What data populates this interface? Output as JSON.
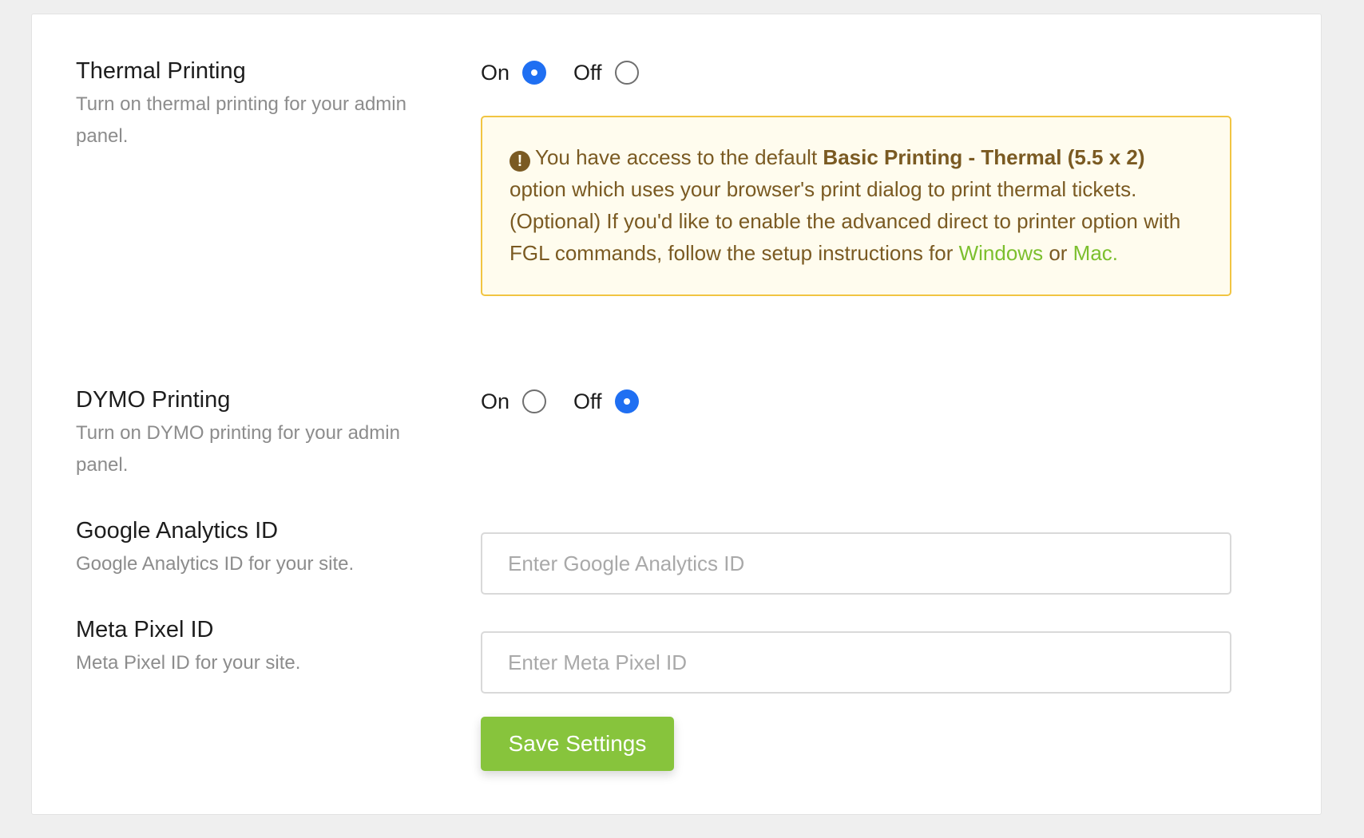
{
  "thermal": {
    "title": "Thermal Printing",
    "description": "Turn on thermal printing for your admin panel.",
    "on_label": "On",
    "off_label": "Off",
    "selected": "On",
    "alert": {
      "icon": "exclamation-circle-icon",
      "text_before": "You have access to the default ",
      "bold_text": "Basic Printing - Thermal (5.5 x 2)",
      "text_after": " option which uses your browser's print dialog to print thermal tickets. (Optional) If you'd like to enable the advanced direct to printer option with FGL commands, follow the setup instructions for ",
      "link_windows": "Windows",
      "or_text": " or ",
      "link_mac": "Mac."
    }
  },
  "dymo": {
    "title": "DYMO Printing",
    "description": "Turn on DYMO printing for your admin panel.",
    "on_label": "On",
    "off_label": "Off",
    "selected": "Off"
  },
  "google_analytics": {
    "title": "Google Analytics ID",
    "description": "Google Analytics ID for your site.",
    "value": "",
    "placeholder": "Enter Google Analytics ID"
  },
  "meta_pixel": {
    "title": "Meta Pixel ID",
    "description": "Meta Pixel ID for your site.",
    "value": "",
    "placeholder": "Enter Meta Pixel ID"
  },
  "save_button": {
    "label": "Save Settings"
  },
  "colors": {
    "accent_blue": "#1f6ff2",
    "save_green": "#87c43c",
    "link_green": "#7cbf2e",
    "alert_bg": "#fffcee",
    "alert_border": "#f1c542",
    "alert_text": "#7a5a22"
  }
}
